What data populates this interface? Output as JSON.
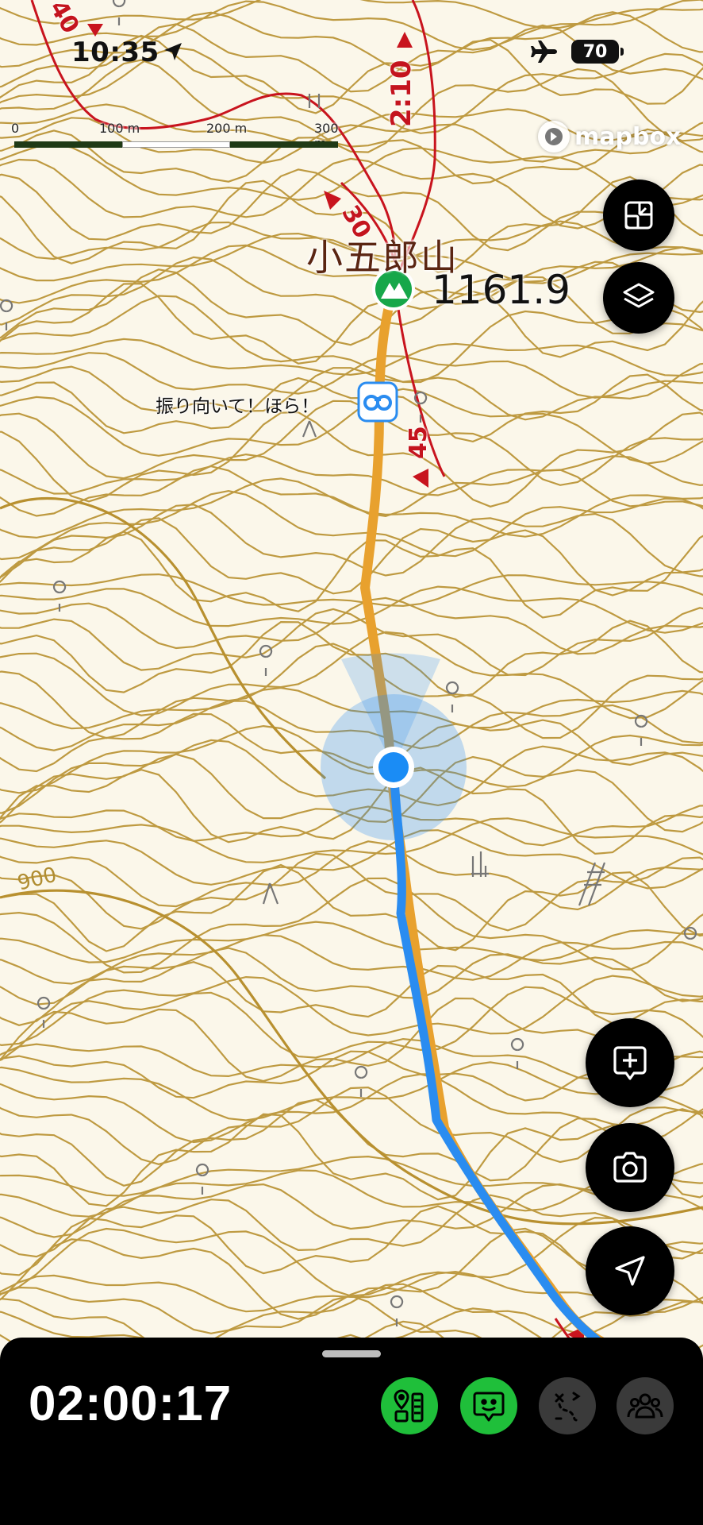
{
  "status_bar": {
    "time": "10:35",
    "battery": "70",
    "airplane_mode": true,
    "location_active": true
  },
  "scale_bar": {
    "ticks": [
      "0",
      "100 m",
      "200 m",
      "300 m"
    ]
  },
  "attribution": {
    "text": "mapbox"
  },
  "map": {
    "peak_name": "小五郎山",
    "peak_elevation": "1161.9",
    "viewpoint_label": "振り向いて！ほら！",
    "contour_label": "900",
    "course_times": [
      "2:10",
      "30",
      "45",
      "40"
    ],
    "icons": {
      "peak_marker": "mountain-icon",
      "viewpoint_marker": "binoculars-icon",
      "current_location": "location-dot"
    },
    "colors": {
      "planned_route": "#e8a12e",
      "track": "#2a8cf0",
      "course_line": "#c8141e",
      "contour": "#b8902f",
      "background": "#fbf7ea"
    }
  },
  "map_controls": {
    "top": [
      "fullscreen-exit-icon",
      "layers-icon"
    ],
    "bottom": [
      "add-memo-icon",
      "camera-icon",
      "location-arrow-icon"
    ]
  },
  "bottom_sheet": {
    "elapsed_time": "02:00:17",
    "actions": [
      {
        "icon": "checkpoint-icon",
        "active": true,
        "color": "#1fbf3a"
      },
      {
        "icon": "status-message-icon",
        "active": true,
        "color": "#1fbf3a"
      },
      {
        "icon": "route-off-icon",
        "active": false,
        "color": "#3a3a3a"
      },
      {
        "icon": "group-icon",
        "active": false,
        "color": "#3a3a3a"
      }
    ]
  }
}
